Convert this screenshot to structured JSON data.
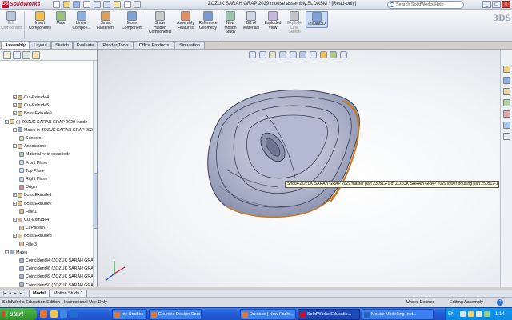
{
  "app": {
    "name": "SolidWorks",
    "logo_letters": "DS",
    "document_title": "ZOZUK SARAH GRAP 2029 mouse assembly.SLDASM * [Read-only]",
    "help_search_placeholder": "Search SolidWorks Help",
    "window_controls": [
      "_",
      "□",
      "×"
    ]
  },
  "ribbon": {
    "commands": [
      {
        "label": "Edit Component",
        "icon": "edit-component-icon",
        "disabled": true
      },
      {
        "label": "Insert Components",
        "icon": "insert-components-icon"
      },
      {
        "label": "Mate",
        "icon": "mate-icon"
      },
      {
        "label": "Linear Compon...",
        "icon": "linear-pattern-icon"
      },
      {
        "label": "Smart Fasteners",
        "icon": "smart-fasteners-icon"
      },
      {
        "label": "Move Component",
        "icon": "move-component-icon"
      },
      {
        "label": "Show Hidden Components",
        "icon": "show-hidden-icon"
      },
      {
        "label": "Assembly Features",
        "icon": "assembly-features-icon"
      },
      {
        "label": "Reference Geometry",
        "icon": "reference-geometry-icon"
      },
      {
        "label": "New Motion Study",
        "icon": "motion-study-icon"
      },
      {
        "label": "Bill of Materials",
        "icon": "bom-icon"
      },
      {
        "label": "Exploded View",
        "icon": "exploded-view-icon"
      },
      {
        "label": "Explode Line Sketch",
        "icon": "explode-line-icon",
        "disabled": true
      },
      {
        "label": "Instant3D",
        "icon": "instant3d-icon",
        "active": true
      }
    ]
  },
  "tabs": [
    "Assembly",
    "Layout",
    "Sketch",
    "Evaluate",
    "Render Tools",
    "Office Products",
    "Simulation"
  ],
  "tree": {
    "items": [
      {
        "label": "Cut-Extrude4",
        "indent": 1,
        "expand": "+",
        "icon": "cut-extrude"
      },
      {
        "label": "Cut-Extrude5",
        "indent": 1,
        "expand": "+",
        "icon": "cut-extrude"
      },
      {
        "label": "Boss-Extrude9",
        "indent": 1,
        "expand": "+",
        "icon": "boss-extrude"
      },
      {
        "label": "(-) ZOZUK SARAH GRAP 2029 inside",
        "indent": 0,
        "expand": "-",
        "icon": "part"
      },
      {
        "label": "Mates in ZOZUK SARAH GRAP 2029",
        "indent": 1,
        "expand": "+",
        "icon": "mates"
      },
      {
        "label": "Sensors",
        "indent": 1,
        "expand": "",
        "icon": "sensors"
      },
      {
        "label": "Annotations",
        "indent": 1,
        "expand": "+",
        "icon": "annotations"
      },
      {
        "label": "Material <not specified>",
        "indent": 1,
        "expand": "",
        "icon": "material"
      },
      {
        "label": "Front Plane",
        "indent": 1,
        "expand": "",
        "icon": "plane"
      },
      {
        "label": "Top Plane",
        "indent": 1,
        "expand": "",
        "icon": "plane"
      },
      {
        "label": "Right Plane",
        "indent": 1,
        "expand": "",
        "icon": "plane"
      },
      {
        "label": "Origin",
        "indent": 1,
        "expand": "",
        "icon": "origin"
      },
      {
        "label": "Boss-Extrude1",
        "indent": 1,
        "expand": "+",
        "icon": "boss-extrude"
      },
      {
        "label": "Boss-Extrude2",
        "indent": 1,
        "expand": "+",
        "icon": "boss-extrude"
      },
      {
        "label": "Fillet1",
        "indent": 1,
        "expand": "",
        "icon": "fillet"
      },
      {
        "label": "Cut-Extrude4",
        "indent": 1,
        "expand": "+",
        "icon": "cut-extrude"
      },
      {
        "label": "CirPattern7",
        "indent": 1,
        "expand": "",
        "icon": "pattern"
      },
      {
        "label": "Boss-Extrude8",
        "indent": 1,
        "expand": "+",
        "icon": "boss-extrude"
      },
      {
        "label": "Fillet3",
        "indent": 1,
        "expand": "",
        "icon": "fillet"
      },
      {
        "label": "Mates",
        "indent": 0,
        "expand": "-",
        "icon": "mates"
      },
      {
        "label": "Coincident44 (ZOZUK SARAH GRAP",
        "indent": 1,
        "expand": "",
        "icon": "coincident"
      },
      {
        "label": "Coincident46 (ZOZUK SARAH GRAP",
        "indent": 1,
        "expand": "",
        "icon": "coincident"
      },
      {
        "label": "Coincident49 (ZOZUK SARAH GRAP",
        "indent": 1,
        "expand": "",
        "icon": "coincident"
      },
      {
        "label": "Coincident60 (ZOZUK SARAH GRAP",
        "indent": 1,
        "expand": "",
        "icon": "coincident"
      },
      {
        "label": "Coincident65 (ZOZUK SARAH GRAP",
        "indent": 1,
        "expand": "",
        "icon": "coincident"
      },
      {
        "label": "Coincident69 (ZOZUK SARAH GRAP",
        "indent": 1,
        "expand": "",
        "icon": "coincident"
      },
      {
        "label": "Distance2 (ZOZUK SARAH GRAP 20",
        "indent": 1,
        "expand": "",
        "icon": "distance"
      },
      {
        "label": "Coincident74 (ZOZUK SARAH GRAP",
        "indent": 1,
        "expand": "",
        "icon": "coincident"
      },
      {
        "label": "Concentric2 (ZOZUK SARAH GRAP",
        "indent": 1,
        "expand": "",
        "icon": "concentric"
      }
    ]
  },
  "viewport": {
    "tooltip": "Shock-ZOZUK SARAH GRAP 2029 master part 230512-1 of ZOZUK SARAH GRAP 2029 lower housing part 250512-1>"
  },
  "bottom_tabs": [
    "Model",
    "Motion Study 1"
  ],
  "nav_arrows": [
    "|◂",
    "◂",
    "▸",
    "▸|"
  ],
  "statusbar": {
    "left": "SolidWorks Education Edition - Instructional Use Only",
    "state": "Under Defined",
    "mode": "Editing Assembly",
    "help": "?"
  },
  "taskbar": {
    "start_label": "start",
    "tasks": [
      {
        "label": "my Studies - Mozilla ...",
        "active": false,
        "color": "#e8742a"
      },
      {
        "label": "Courses Design Com...",
        "active": false,
        "color": "#e8742a"
      },
      {
        "label": "Dresses | New Fashi...",
        "active": false,
        "color": "#e8742a"
      },
      {
        "label": "SolidWorks Educatio...",
        "active": true,
        "color": "#c8102e"
      },
      {
        "label": "Mouse Modelling Inst...",
        "active": false,
        "color": "#2d5fb4"
      }
    ],
    "language": "EN",
    "clock": "1:14 AM"
  }
}
